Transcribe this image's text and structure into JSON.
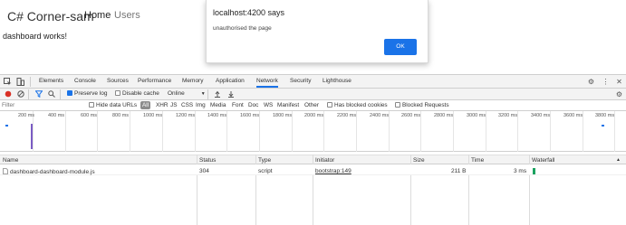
{
  "page": {
    "brand": "C# Corner-sam",
    "nav": [
      "Home",
      "Users"
    ],
    "content": "dashboard works!"
  },
  "alert": {
    "title": "localhost:4200 says",
    "message": "unauthorised the page",
    "ok_label": "OK"
  },
  "devtools": {
    "tabs": [
      "Elements",
      "Console",
      "Sources",
      "Performance",
      "Memory",
      "Application",
      "Network",
      "Security",
      "Lighthouse"
    ],
    "active_tab": "Network",
    "toolbar": {
      "preserve_log": "Preserve log",
      "disable_cache": "Disable cache",
      "throttle": "Online"
    },
    "filter": {
      "placeholder": "Filter",
      "hide_data_urls": "Hide data URLs",
      "types": [
        "All",
        "XHR",
        "JS",
        "CSS",
        "Img",
        "Media",
        "Font",
        "Doc",
        "WS",
        "Manifest",
        "Other"
      ],
      "has_blocked_cookies": "Has blocked cookies",
      "blocked_requests": "Blocked Requests"
    },
    "timeline_ticks": [
      "200 ms",
      "400 ms",
      "600 ms",
      "800 ms",
      "1000 ms",
      "1200 ms",
      "1400 ms",
      "1600 ms",
      "1800 ms",
      "2000 ms",
      "2200 ms",
      "2400 ms",
      "2600 ms",
      "2800 ms",
      "3000 ms",
      "3200 ms",
      "3400 ms",
      "3600 ms",
      "3800 ms"
    ],
    "columns": [
      "Name",
      "Status",
      "Type",
      "Initiator",
      "Size",
      "Time",
      "Waterfall"
    ],
    "rows": [
      {
        "name": "dashboard-dashboard-module.js",
        "status": "304",
        "type": "script",
        "initiator": "bootstrap:149",
        "size": "211 B",
        "time": "3 ms"
      }
    ],
    "colors": {
      "accent": "#1a73e8",
      "record": "#d93025",
      "waterfall": "#1aa260"
    }
  }
}
